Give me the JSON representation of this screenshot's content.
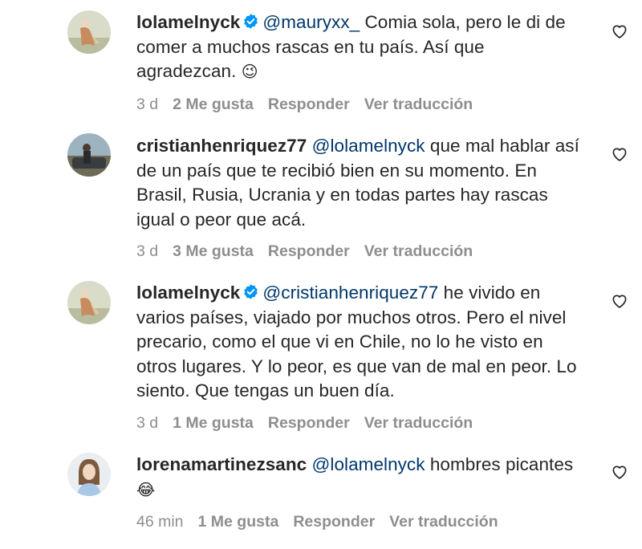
{
  "comments": [
    {
      "username": "lolamelnyck",
      "verified": true,
      "mention": "@mauryxx_",
      "text": " Comia sola, pero le di de comer a muchos rascas en tu país. Así que agradezcan. ",
      "emoji": "😉",
      "time": "3 d",
      "likes": "2 Me gusta",
      "reply": "Responder",
      "translate": "Ver traducción"
    },
    {
      "username": "cristianhenriquez77",
      "verified": false,
      "mention": "@lolamelnyck",
      "text": " que mal hablar así de un país que te recibió bien en su momento. En Brasil, Rusia, Ucrania y en todas partes hay rascas igual o peor que acá.",
      "emoji": "",
      "time": "3 d",
      "likes": "3 Me gusta",
      "reply": "Responder",
      "translate": "Ver traducción"
    },
    {
      "username": "lolamelnyck",
      "verified": true,
      "mention": "@cristianhenriquez77",
      "text": " he vivido en varios países, viajado por muchos otros. Pero el nivel precario, como el que vi en Chile, no lo he visto en otros lugares. Y lo peor, es que van de mal en peor. Lo siento. Que tengas un buen día.",
      "emoji": "",
      "time": "3 d",
      "likes": "1 Me gusta",
      "reply": "Responder",
      "translate": "Ver traducción"
    },
    {
      "username": "lorenamartinezsanc",
      "verified": false,
      "mention": "@lolamelnyck",
      "text": " hombres picantes",
      "emoji": "😂",
      "time": "46 min",
      "likes": "1 Me gusta",
      "reply": "Responder",
      "translate": "Ver traducción"
    }
  ],
  "colors": {
    "text": "#262626",
    "meta": "#8e8e8e",
    "mention": "#00376b",
    "verified": "#0095f6"
  },
  "icons": {
    "like": "heart-outline-icon",
    "verified": "verified-badge-icon"
  }
}
